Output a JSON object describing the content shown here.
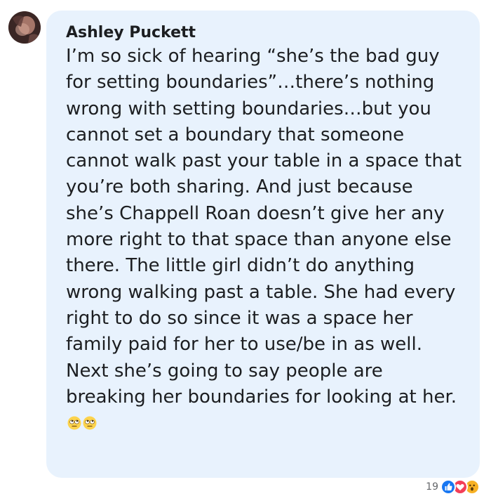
{
  "comment": {
    "author": "Ashley Puckett",
    "text": "I’m so sick of hearing “she’s the bad guy for setting boundaries”…there’s nothing wrong with setting boundaries…but you cannot set a boundary that someone cannot walk past your table in a space that you’re both sharing. And just because she’s Chappell Roan doesn’t give her any more right to that space than anyone else there. The little girl didn’t do anything wrong walking past a table. She had every right to do so since it was a space her family paid for her to use/be in as well. Next she’s going to say people are breaking her boundaries for looking at her.",
    "trailing_emojis": [
      "eye-roll-emoji",
      "eye-roll-emoji"
    ],
    "bubble_color": "#e8f2fd"
  },
  "reactions": {
    "count": "19",
    "types": [
      "like-icon",
      "love-icon",
      "wow-icon"
    ],
    "colors": {
      "like": "#1877f2",
      "love": "#f33e58",
      "wow": "#f7b125"
    }
  }
}
